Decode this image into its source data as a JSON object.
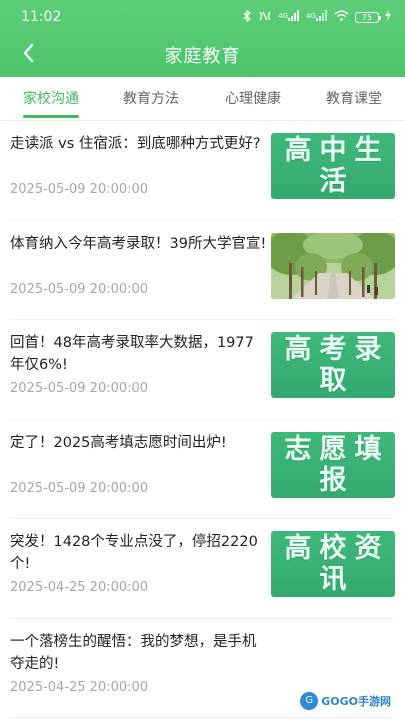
{
  "status_bar": {
    "time": "11:02",
    "icons": [
      "bluetooth-icon",
      "nfc-icon",
      "signal-4g-icon",
      "signal-4g-2-icon",
      "wifi-icon",
      "battery-icon",
      "charging-icon"
    ],
    "network_1": "4G",
    "network_2": "4G",
    "battery_level": "75"
  },
  "header": {
    "back_icon": "chevron-left-icon",
    "title": "家庭教育",
    "color": "#4cc56c"
  },
  "tabs": [
    {
      "label": "家校沟通",
      "active": true
    },
    {
      "label": "教育方法",
      "active": false
    },
    {
      "label": "心理健康",
      "active": false
    },
    {
      "label": "教育课堂",
      "active": false
    }
  ],
  "articles": [
    {
      "title": "走读派 vs 住宿派：到底哪种方式更好?",
      "date": "2025-05-09 20:00:00",
      "thumb_text": "高中生活"
    },
    {
      "title": "体育纳入今年高考录取！39所大学官宣!",
      "date": "2025-05-09 20:00:00",
      "thumb_text": ""
    },
    {
      "title": "回首！48年高考录取率大数据，1977年仅6%!",
      "date": "2025-05-09 20:00:00",
      "thumb_text": "高考录取"
    },
    {
      "title": "定了！2025高考填志愿时间出炉!",
      "date": "2025-05-09 20:00:00",
      "thumb_text": "志愿填报"
    },
    {
      "title": "突发！1428个专业点没了，停招2220个!",
      "date": "2025-04-25 20:00:00",
      "thumb_text": "高校资讯"
    },
    {
      "title": "一个落榜生的醒悟：我的梦想，是手机夺走的!",
      "date": "2025-04-25 20:00:00",
      "thumb_text": ""
    }
  ],
  "watermark": {
    "text": "GOGO手游网",
    "icon": "gogo-logo-icon"
  }
}
